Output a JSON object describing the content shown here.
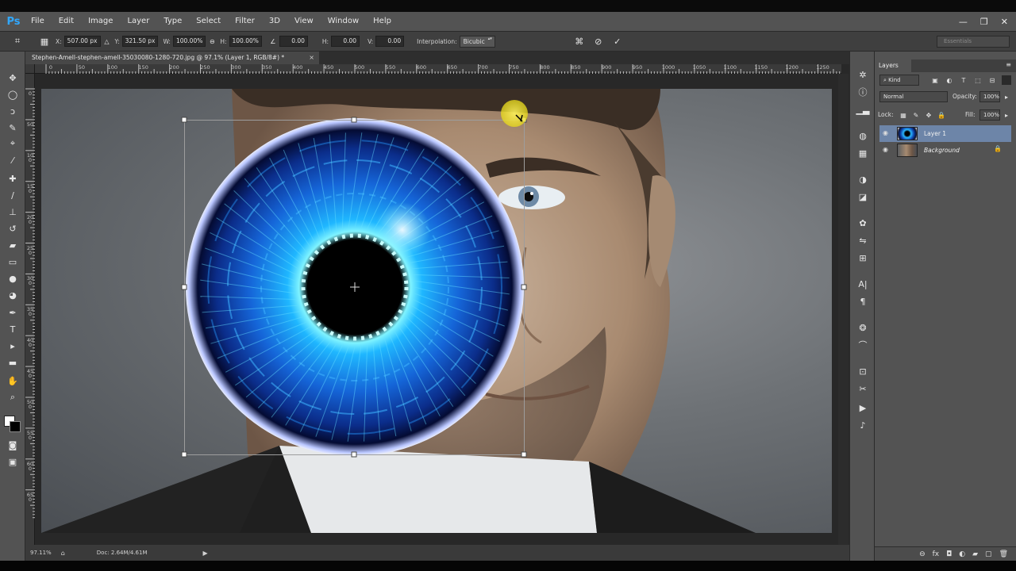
{
  "app": {
    "logo": "Ps"
  },
  "menu": [
    "File",
    "Edit",
    "Image",
    "Layer",
    "Type",
    "Select",
    "Filter",
    "3D",
    "View",
    "Window",
    "Help"
  ],
  "window_controls": {
    "minimize": "—",
    "restore": "❐",
    "close": "✕"
  },
  "options": {
    "x_label": "X:",
    "x_value": "507.00 px",
    "y_label": "Y:",
    "y_value": "321.50 px",
    "w_label": "W:",
    "w_value": "100.00%",
    "h_label": "H:",
    "h_value": "100.00%",
    "angle_value": "0.00",
    "hskew_label": "H:",
    "hskew_value": "0.00",
    "vskew_label": "V:",
    "vskew_value": "0.00",
    "interpolation_label": "Interpolation:",
    "interpolation_value": "Bicubic",
    "workspace": "Essentials"
  },
  "document": {
    "tab_title": "Stephen-Amell-stephen-amell-35030080-1280-720.jpg @ 97.1% (Layer 1, RGB/8#) *",
    "tab_close": "×"
  },
  "ruler_h": [
    "0",
    "50",
    "100",
    "150",
    "200",
    "250",
    "300",
    "350",
    "400",
    "450",
    "500",
    "550",
    "600",
    "650",
    "700",
    "750",
    "800",
    "850",
    "900",
    "950",
    "1000",
    "1050",
    "1100",
    "1150",
    "1200",
    "1250"
  ],
  "ruler_v": [
    "0",
    "50",
    "100",
    "150",
    "200",
    "250",
    "300",
    "350",
    "400",
    "450",
    "500",
    "550",
    "600",
    "650"
  ],
  "status": {
    "zoom": "97.11%",
    "doc": "Doc: 2.64M/4.61M"
  },
  "layers_panel": {
    "tab": "Layers",
    "kind_filter": "Kind",
    "blend_mode": "Normal",
    "opacity_label": "Opacity:",
    "opacity_value": "100%",
    "lock_label": "Lock:",
    "fill_label": "Fill:",
    "fill_value": "100%",
    "layers": [
      {
        "name": "Layer 1",
        "selected": true,
        "locked": false
      },
      {
        "name": "Background",
        "selected": false,
        "locked": true
      }
    ]
  },
  "colors": {
    "accent": "#6d85a8",
    "ui_gray": "#535353",
    "eye_blue": "#1e73ff"
  }
}
